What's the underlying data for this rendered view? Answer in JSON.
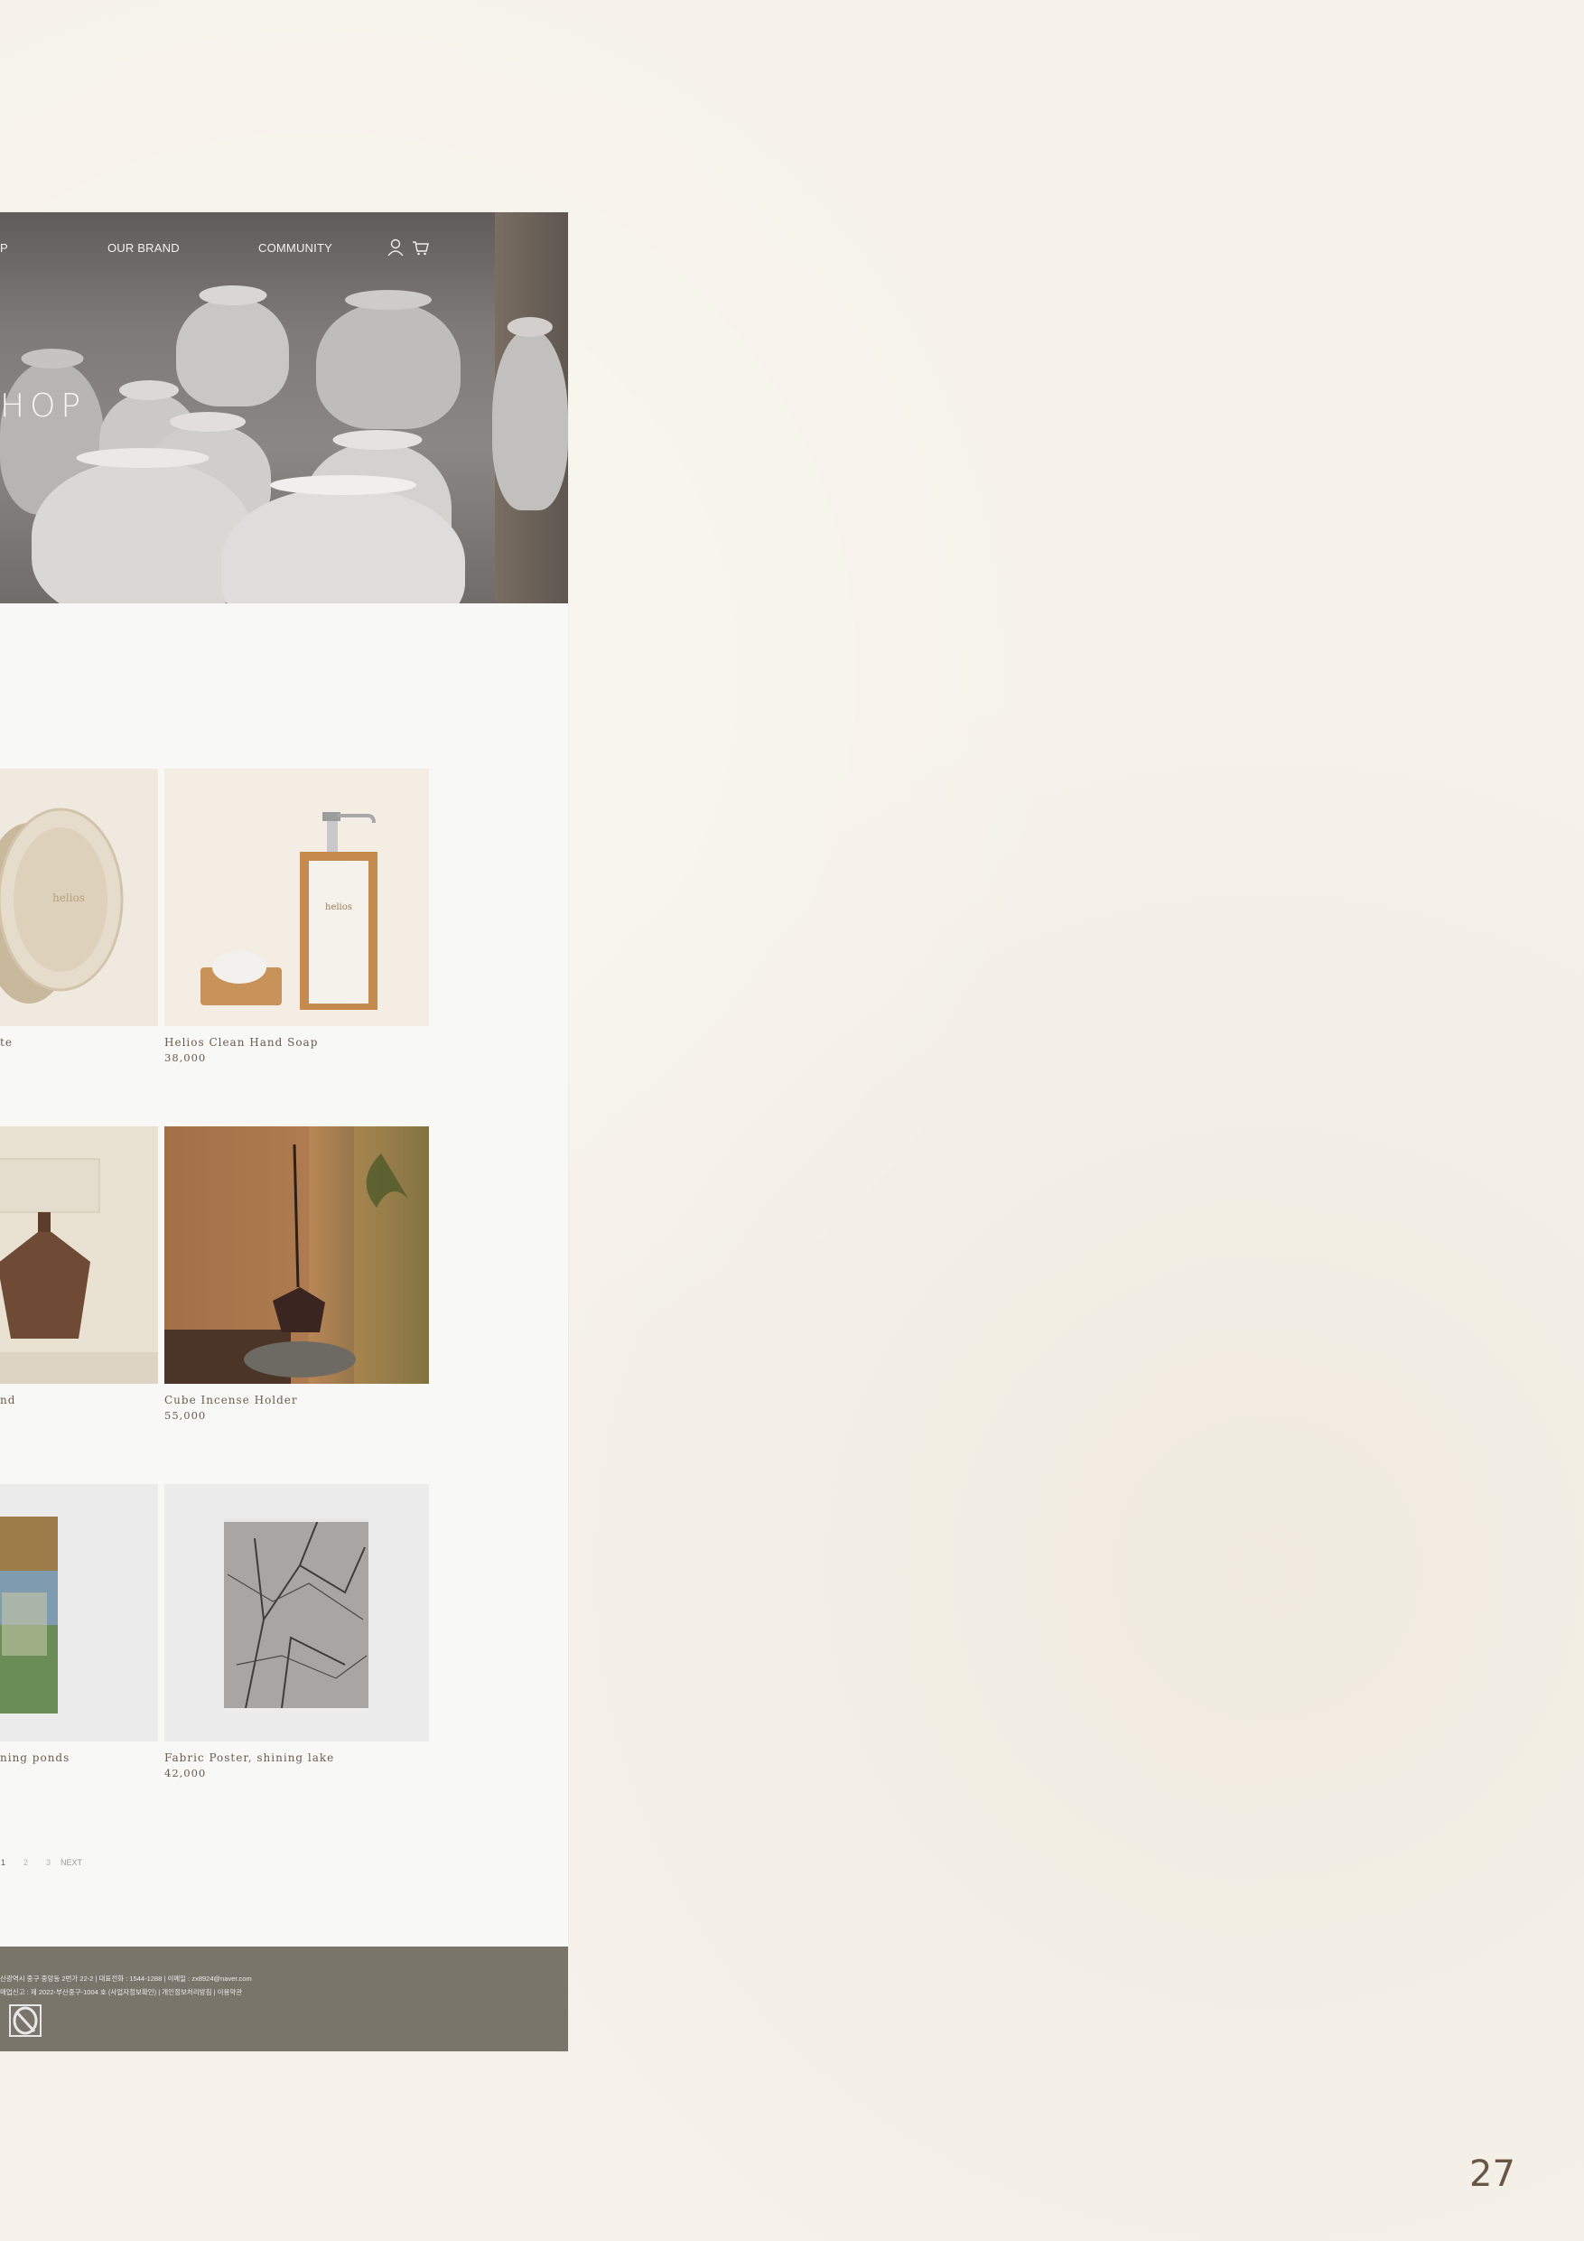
{
  "nav": {
    "first_fragment": "P",
    "brand": "OUR BRAND",
    "community": "COMMUNITY"
  },
  "hero": {
    "title": "HOP"
  },
  "products": [
    {
      "name": "te",
      "price": ""
    },
    {
      "name": "Helios Clean Hand Soap",
      "price": "38,000"
    },
    {
      "name": "nd",
      "price": ""
    },
    {
      "name": "Cube Incense Holder",
      "price": "55,000"
    },
    {
      "name": "ning ponds",
      "price": ""
    },
    {
      "name": "Fabric Poster, shining lake",
      "price": "42,000"
    }
  ],
  "product_labels": {
    "plate": "helios",
    "soap": "helios"
  },
  "pagination": {
    "p1": "1",
    "p2": "2",
    "p3": "3",
    "next": "NEXT"
  },
  "footer": {
    "line1": "산광역시 중구 중앙동 2번가 22-2 | 대표전화 : 1544-1288 | 이메일 : zx8924@naver.com",
    "line2": "매업신고 : 제 2022-부산중구-1004 호 (사업자정보확인) | 개인정보처리방침 | 이용약관"
  },
  "page_number": "27",
  "colors": {
    "background": "#f6f2ea",
    "footer": "#7a756b",
    "product_text": "#6b5a4d",
    "page_number": "#6a5645"
  }
}
